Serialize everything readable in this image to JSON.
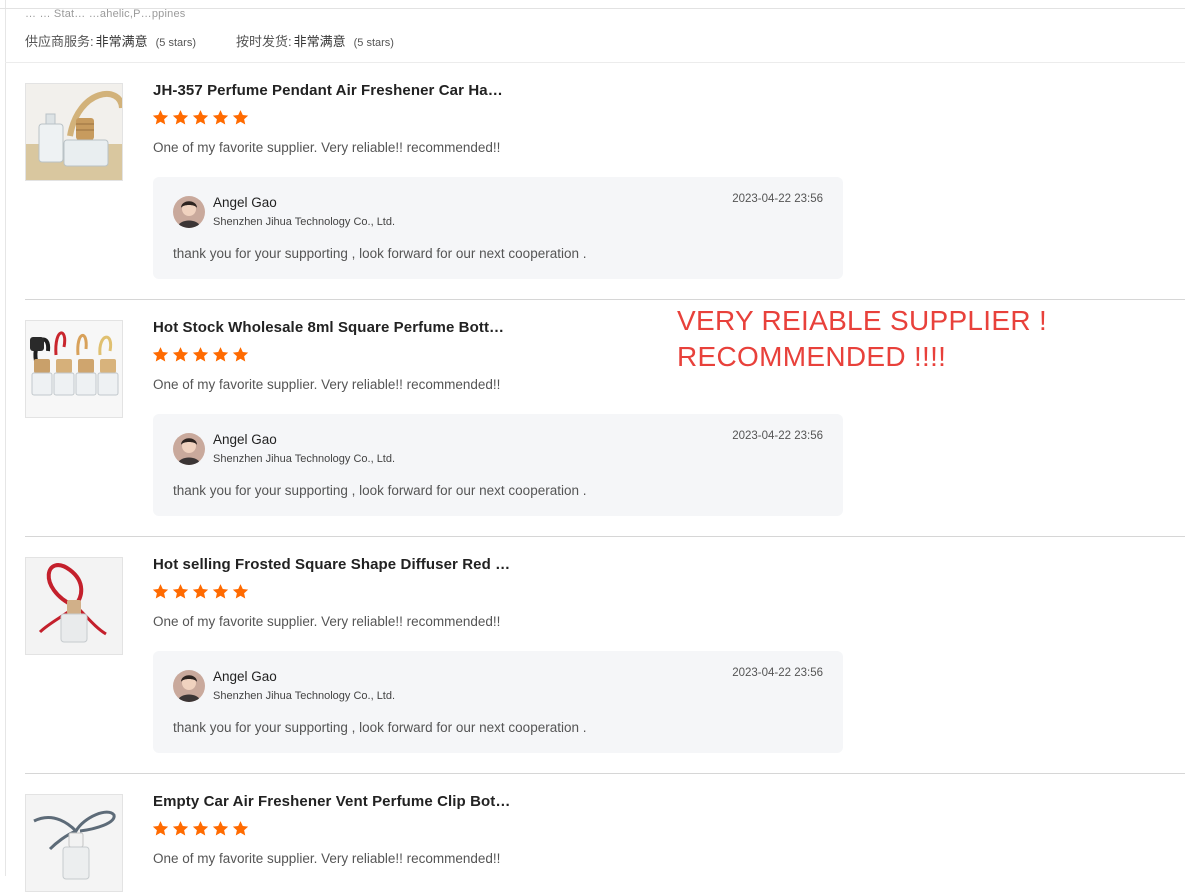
{
  "header": {
    "faded_text": "… … Stat… …ahelic,P…ppines",
    "ratings": [
      {
        "label": "供应商服务:",
        "value": "非常满意",
        "stars_text": "(5 stars)"
      },
      {
        "label": "按时发货:",
        "value": "非常满意",
        "stars_text": "(5 stars)"
      }
    ]
  },
  "annotation": {
    "line1": "VERY REIABLE SUPPLIER !",
    "line2": "RECOMMENDED !!!!",
    "color": "#e8413b"
  },
  "colors": {
    "star": "#ff6a00",
    "reply_bg": "#f5f6f8",
    "annotation": "#e8413b"
  },
  "reviews": [
    {
      "title": "JH-357 Perfume Pendant Air Freshener Car Ha…",
      "rating": 5,
      "text": "One of my favorite supplier. Very reliable!! recommended!!",
      "thumbnail_icon": "perfume-bottle-wooden-cap-icon",
      "reply": {
        "name": "Angel Gao",
        "company": "Shenzhen Jihua Technology Co., Ltd.",
        "date": "2023-04-22 23:56",
        "text": "thank you for your supporting , look forward for our next cooperation ."
      }
    },
    {
      "title": "Hot Stock Wholesale 8ml Square Perfume Bott…",
      "rating": 5,
      "text": "One of my favorite supplier. Very reliable!! recommended!!",
      "thumbnail_icon": "perfume-bottles-group-icon",
      "reply": {
        "name": "Angel Gao",
        "company": "Shenzhen Jihua Technology Co., Ltd.",
        "date": "2023-04-22 23:56",
        "text": "thank you for your supporting , look forward for our next cooperation ."
      }
    },
    {
      "title": "Hot selling Frosted Square Shape Diffuser Red …",
      "rating": 5,
      "text": "One of my favorite supplier. Very reliable!! recommended!!",
      "thumbnail_icon": "frosted-bottle-red-string-icon",
      "reply": {
        "name": "Angel Gao",
        "company": "Shenzhen Jihua Technology Co., Ltd.",
        "date": "2023-04-22 23:56",
        "text": "thank you for your supporting , look forward for our next cooperation ."
      }
    },
    {
      "title": "Empty Car Air Freshener Vent Perfume Clip Bot…",
      "rating": 5,
      "text": "One of my favorite supplier. Very reliable!! recommended!!",
      "thumbnail_icon": "vent-clip-bottle-icon"
    }
  ]
}
